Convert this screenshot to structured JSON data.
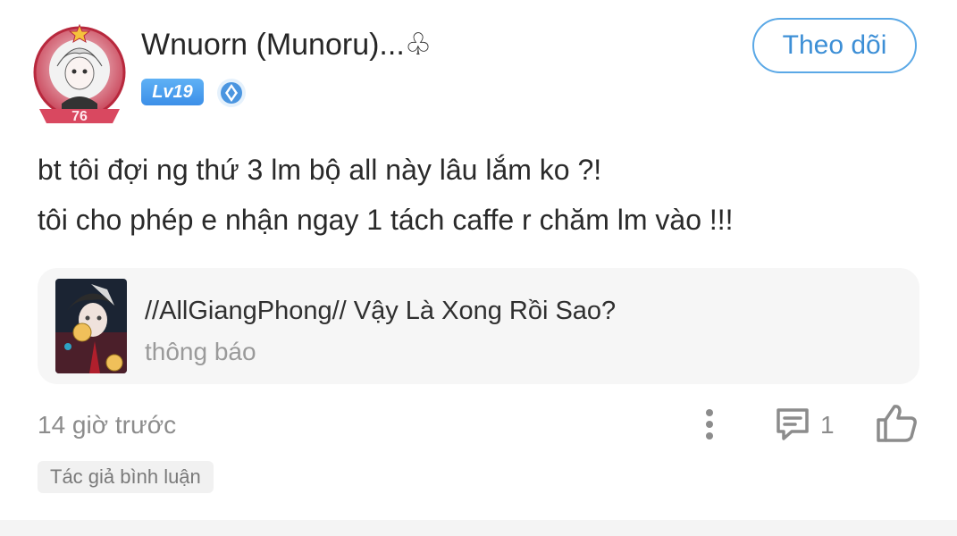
{
  "user": {
    "name": "Wnuorn (Munoru)...♧",
    "level": "Lv19",
    "avatar_number": "76"
  },
  "follow_button": {
    "label": "Theo dõi"
  },
  "comment": {
    "lines": [
      "bt tôi đợi ng thứ 3 lm bộ all này lâu lắm ko ?!",
      "tôi cho phép e nhận ngay 1 tách caffe r chăm lm vào !!!"
    ]
  },
  "story": {
    "title": "//AllGiangPhong// Vậy Là Xong Rồi Sao?",
    "subtitle": "thông báo"
  },
  "footer": {
    "timestamp": "14 giờ trước",
    "reply_count": "1",
    "author_tag": "Tác giả bình luận"
  },
  "icons": {
    "more": "more-vertical-icon",
    "reply": "comment-icon",
    "like": "thumbs-up-icon",
    "vip": "vip-badge-icon"
  },
  "colors": {
    "accent": "#3d8fd6",
    "level_badge": "#4a9cf0",
    "muted_text": "#8c8c8c",
    "card_bg": "#f6f6f6"
  }
}
